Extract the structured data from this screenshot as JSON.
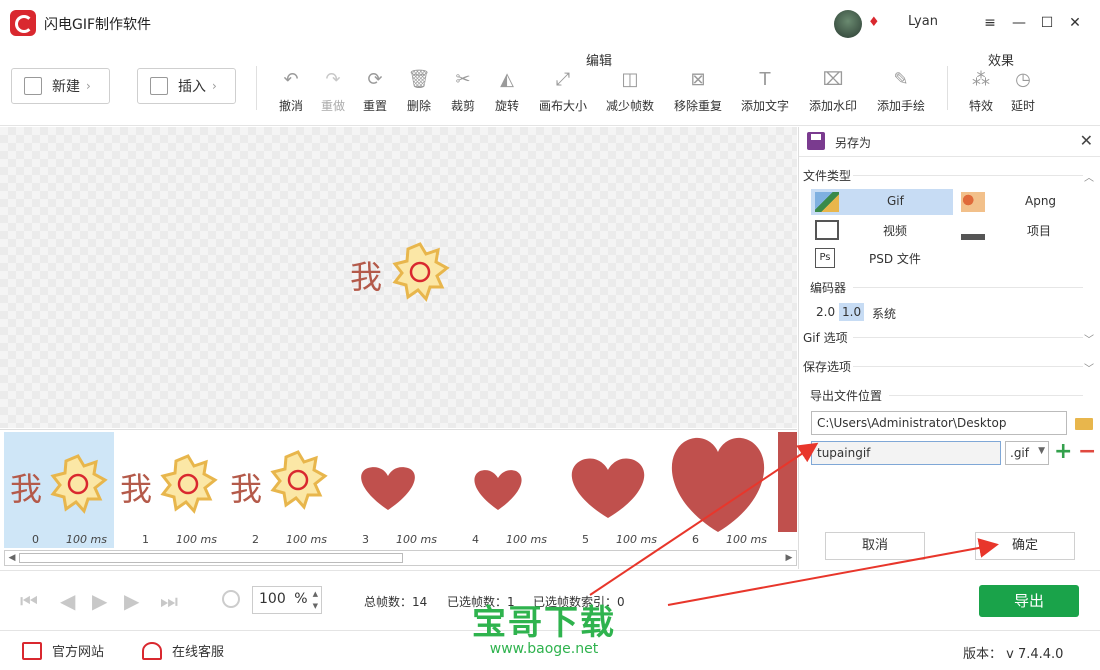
{
  "app": {
    "title": "闪电GIF制作软件",
    "username": "Lyan"
  },
  "window": {
    "min": "—",
    "max": "☐",
    "close": "✕",
    "menu": "≡"
  },
  "toolbar": {
    "new_label": "新建",
    "insert_label": "插入",
    "edit_group": "编辑",
    "effect_group": "效果",
    "tools": [
      {
        "label": "撤消",
        "glyph": "↶"
      },
      {
        "label": "重做",
        "glyph": "↷"
      },
      {
        "label": "重置",
        "glyph": "⟳"
      },
      {
        "label": "删除",
        "glyph": "🗑"
      },
      {
        "label": "裁剪",
        "glyph": "✂"
      },
      {
        "label": "旋转",
        "glyph": "◭"
      },
      {
        "label": "画布大小",
        "glyph": "⤢"
      },
      {
        "label": "减少帧数",
        "glyph": "◫"
      },
      {
        "label": "移除重复",
        "glyph": "⊠"
      },
      {
        "label": "添加文字",
        "glyph": "T"
      },
      {
        "label": "添加水印",
        "glyph": "⌧"
      },
      {
        "label": "添加手绘",
        "glyph": "✎"
      },
      {
        "label": "特效",
        "glyph": "⁂"
      },
      {
        "label": "延时",
        "glyph": "◷"
      }
    ]
  },
  "frames": [
    {
      "num": "0",
      "ms": "100 ms"
    },
    {
      "num": "1",
      "ms": "100 ms"
    },
    {
      "num": "2",
      "ms": "100 ms"
    },
    {
      "num": "3",
      "ms": "100 ms"
    },
    {
      "num": "4",
      "ms": "100 ms"
    },
    {
      "num": "5",
      "ms": "100 ms"
    },
    {
      "num": "6",
      "ms": "100 ms"
    }
  ],
  "sticker_text": "我",
  "controls": {
    "zoom": "100",
    "zoom_unit": "%",
    "total_frames": "总帧数：14",
    "selected_frames": "已选帧数：1",
    "selected_index": "已选帧数索引：0",
    "export": "导出"
  },
  "footer": {
    "website": "官方网站",
    "support": "在线客服",
    "version": "版本： v 7.4.4.0"
  },
  "watermark": {
    "main": "宝哥下载",
    "url": "www.baoge.net"
  },
  "panel": {
    "title": "另存为",
    "file_type": "文件类型",
    "types": {
      "gif": "Gif",
      "apng": "Apng",
      "video": "视频",
      "project": "项目",
      "psd": "PSD 文件"
    },
    "encoder": "编码器",
    "codecs": {
      "v20": "2.0",
      "v10": "1.0",
      "system": "系统"
    },
    "gif_options": "Gif 选项",
    "save_options": "保存选项",
    "export_location": "导出文件位置",
    "path": "C:\\Users\\Administrator\\Desktop",
    "filename": "tupaingif",
    "extension": ".gif",
    "cancel": "取消",
    "ok": "确定"
  },
  "colors": {
    "accent_green": "#1aa34a",
    "brand_red": "#d9282f",
    "selection_blue": "#c7dcf4"
  }
}
